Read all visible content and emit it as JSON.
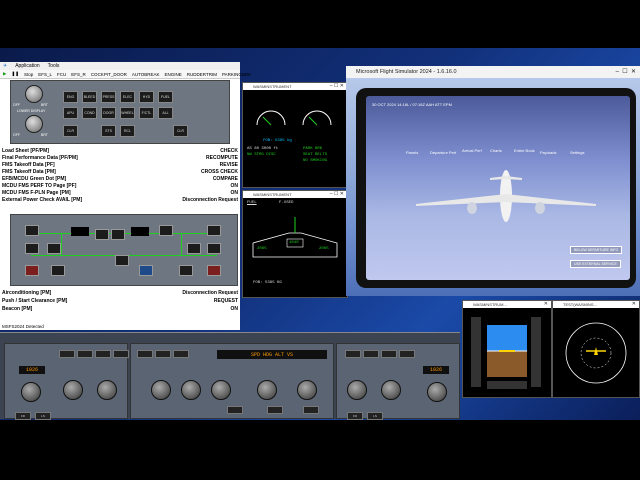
{
  "app": {
    "menu": [
      "Application",
      "Tools"
    ],
    "toolbar": [
      "Stop",
      "EFS_L",
      "FCU",
      "EFS_R",
      "COCKPIT_DOOR",
      "AUTOBREAK",
      "ENGINE",
      "RUDDERTRIM",
      "PARKINGBRK"
    ],
    "overhead_labels": [
      "LOWER DISPLAY",
      "OFF",
      "BRT",
      "OFF",
      "BRT"
    ],
    "overhead_buttons": [
      "ENG",
      "BLEED",
      "PRESS",
      "ELEC",
      "HYD",
      "FUEL",
      "APU",
      "COND",
      "DOOR",
      "WHEEL",
      "F/CTL",
      "ALL",
      "CLR",
      "STS",
      "RCL",
      "CLR"
    ],
    "checklist": [
      {
        "item": "Load Sheet  [PF/PM]",
        "value": "CHECK"
      },
      {
        "item": "Final Performance Data  [PF/PM]",
        "value": "RECOMPUTE"
      },
      {
        "item": "FMS Takeoff Data  [PF]",
        "value": "REVISE"
      },
      {
        "item": "FMS Takeoff Data  [PM]",
        "value": "CROSS CHECK"
      },
      {
        "item": "EFB/MCDU Green Dot  [PM]",
        "value": "COMPARE"
      },
      {
        "item": "MCDU FMS PERF TO Page  [PF]",
        "value": "ON"
      },
      {
        "item": "MCDU FMS F-PLN Page  [PM]",
        "value": "ON"
      },
      {
        "item": "External Power Check AVAIL  [PM]",
        "value": "Disconnection Request"
      }
    ],
    "checklist2": [
      {
        "item": "Airconditioning  [PM]",
        "value": "Disconnection Request"
      },
      {
        "item": "Push / Start Clearance  [PM]",
        "value": "REQUEST"
      },
      {
        "item": "Beacon  [PM]",
        "value": "ON"
      }
    ],
    "status": "MSFS2024 Detected",
    "elec_displays": [
      "",
      "",
      "",
      ""
    ]
  },
  "instruments": {
    "upper_title": "WASMINSTRUMENT",
    "upper_fob": "FOB: 5385 kg",
    "upper_msgs": [
      "AS 80  3000 ft",
      "NW STRG DISC",
      "PARK BRK",
      "SEAT BELTS",
      "NO SMOKING"
    ],
    "lower_title": "WASMINSTRUMENT",
    "lower_fuel": "FUEL",
    "lower_fu": "F.USED",
    "lower_vals": [
      "2065",
      "1040",
      "2065"
    ],
    "lower_fob": "FOB:  5385 KG",
    "pfd_title": "WASMINSTRUM...",
    "nd_title": "TEST(WASMINS..."
  },
  "sim": {
    "title": "Microsoft Flight Simulator 2024 - 1.6.16.0",
    "efb_date": "30 OCT 2024   14:16L / 07:16Z   AAH ATT EPM",
    "efb_tabs": [
      "Panels",
      "Departure Perf",
      "Arrival Perf",
      "Charts",
      "Entire Book",
      "Payloads",
      "Settings"
    ],
    "efb_btn1": "BELOW DEPARTURE INFO",
    "efb_btn2": "USE EXTERNAL SERVICE"
  },
  "fcu": {
    "left_qnh": "1026",
    "center_disp": "SPD  HDG  ALT  VS",
    "right_qnh": "1026",
    "left_labels": [
      "FD",
      "LS",
      "ROSE",
      "NAV",
      "ARC",
      "PLAN"
    ],
    "right_labels": [
      "FD",
      "LS",
      "ROSE",
      "NAV",
      "ARC",
      "PLAN"
    ]
  }
}
